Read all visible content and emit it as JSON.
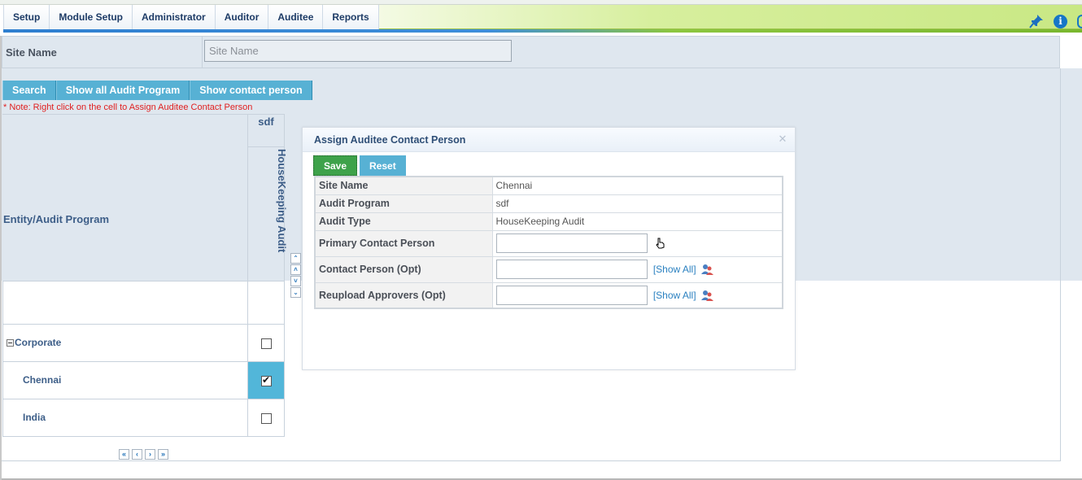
{
  "menu": {
    "items": [
      "Setup",
      "Module Setup",
      "Administrator",
      "Auditor",
      "Auditee",
      "Reports"
    ]
  },
  "filter": {
    "site_label": "Site Name",
    "site_placeholder": "Site Name"
  },
  "buttons": {
    "search": "Search",
    "show_all_audit_program": "Show all Audit Program",
    "show_contact_person": "Show contact person"
  },
  "note": "* Note: Right click on the cell to Assign Auditee Contact Person",
  "grid": {
    "entity_header": "Entity/Audit Program",
    "program_header": "sdf",
    "audit_type_header": "HouseKeeping Audit",
    "rows": [
      {
        "name": "Corporate",
        "checked": false
      },
      {
        "name": "Chennai",
        "checked": true
      },
      {
        "name": "India",
        "checked": false
      }
    ]
  },
  "dialog": {
    "title": "Assign Auditee Contact Person",
    "save": "Save",
    "reset": "Reset",
    "fields": {
      "site_name_label": "Site Name",
      "site_name_value": "Chennai",
      "audit_program_label": "Audit Program",
      "audit_program_value": "sdf",
      "audit_type_label": "Audit Type",
      "audit_type_value": "HouseKeeping Audit",
      "primary_contact_label": "Primary Contact Person",
      "contact_person_label": "Contact Person (Opt)",
      "reupload_label": "Reupload Approvers (Opt)",
      "show_all": "[Show All]"
    }
  },
  "colors": {
    "accent_blue": "#57b1d4",
    "save_green": "#3ea24a",
    "note_red": "#e02020",
    "panel_gray": "#dfe7ef"
  }
}
